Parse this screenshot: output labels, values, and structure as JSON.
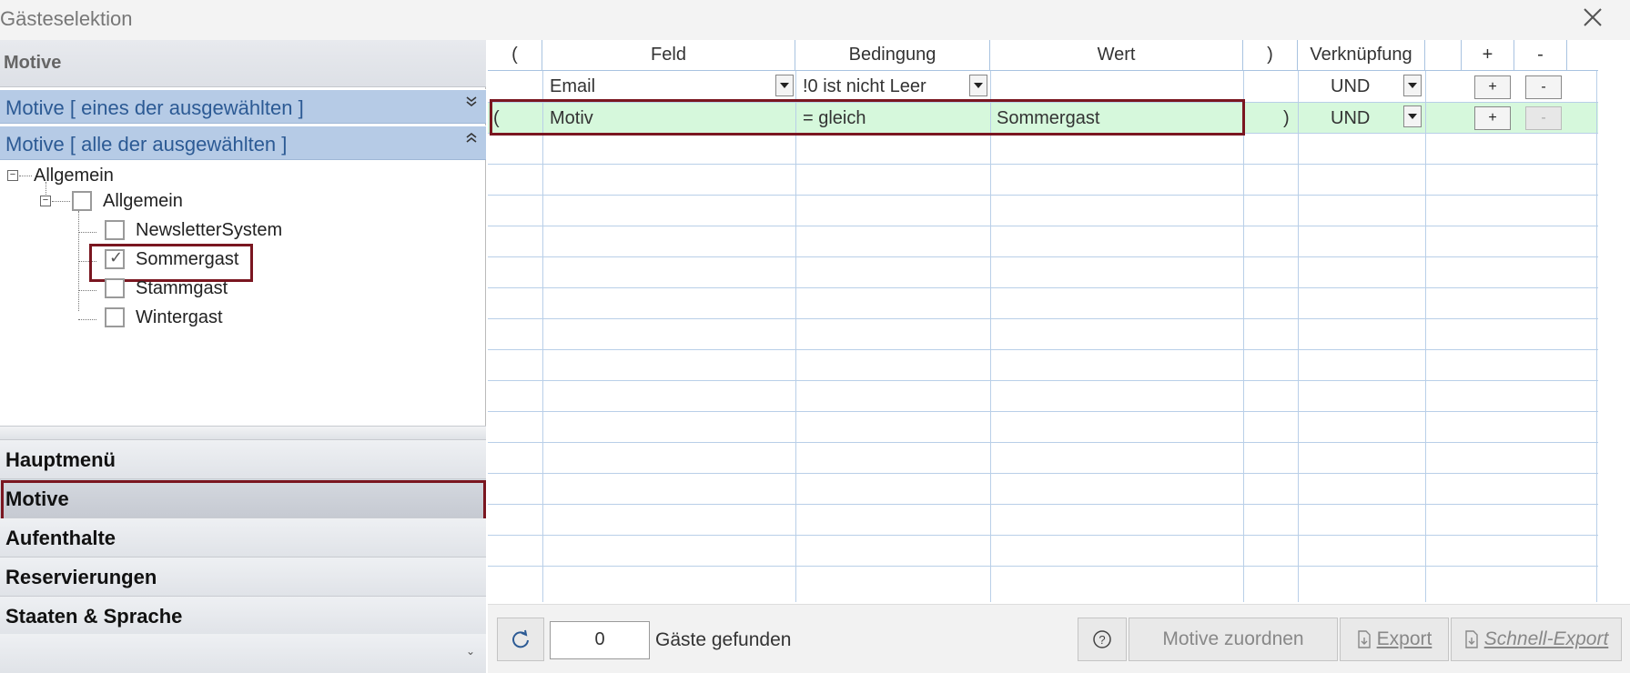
{
  "window": {
    "title": "Gästeselektion"
  },
  "left_panel": {
    "header": "Motive",
    "group_bars": [
      {
        "label": "Motive [ eines der ausgewählten ]",
        "chevron": "»"
      },
      {
        "label": "Motive [ alle der ausgewählten ]",
        "chevron": "«"
      }
    ],
    "tree": {
      "root": "Allgemein",
      "child": "Allgemein",
      "items": [
        {
          "label": "NewsletterSystem",
          "checked": false
        },
        {
          "label": "Sommergast",
          "checked": true
        },
        {
          "label": "Stammgast",
          "checked": false
        },
        {
          "label": "Wintergast",
          "checked": false
        }
      ]
    },
    "nav": [
      {
        "label": "Hauptmenü"
      },
      {
        "label": "Motive"
      },
      {
        "label": "Aufenthalte"
      },
      {
        "label": "Reservierungen"
      },
      {
        "label": "Staaten & Sprache"
      }
    ],
    "footer_chevron": "⌄"
  },
  "grid": {
    "headers": [
      "(",
      "Feld",
      "Bedingung",
      "Wert",
      ")",
      "Verknüpfung",
      "+",
      "-"
    ],
    "rows": [
      {
        "open": "",
        "field": "Email",
        "condition": "!0 ist nicht Leer",
        "value": "",
        "close": "",
        "link": "UND",
        "plus": "+",
        "minus": "-",
        "minus_disabled": false
      },
      {
        "open": "(",
        "field": "Motiv",
        "condition": "=  gleich",
        "value": "Sommergast",
        "close": ")",
        "link": "UND",
        "plus": "+",
        "minus": "-",
        "minus_disabled": true
      }
    ],
    "colors": {
      "selected_row": "#d6f8dc",
      "highlight": "#7a1620",
      "gridline": "#b9cfe8"
    }
  },
  "bottom": {
    "count": "0",
    "found_label": "Gäste gefunden",
    "buttons": {
      "assign": "Motive zuordnen",
      "export": "Export",
      "quick_export": "Schnell-Export"
    }
  }
}
